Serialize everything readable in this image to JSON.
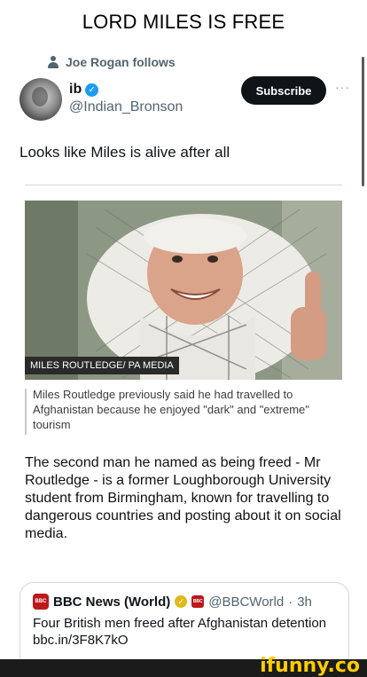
{
  "meme_title": "LORD MILES IS FREE",
  "social_context": {
    "text": "Joe Rogan follows",
    "icon": "person-icon"
  },
  "author": {
    "display_name": "ib",
    "verified_icon": "verified-badge-icon",
    "handle": "@Indian_Bronson",
    "subscribe_label": "Subscribe",
    "more_label": "···"
  },
  "tweet": {
    "text": "Looks like Miles is alive after all"
  },
  "article": {
    "photo_credit": "MILES ROUTLEDGE/ PA MEDIA",
    "photo_caption": "Miles Routledge previously said he had travelled to Afghanistan because he enjoyed \"dark\" and \"extreme\" tourism",
    "body": "The second man he named as being freed - Mr Routledge - is a former Loughborough University student from Birmingham, known for travelling to dangerous countries and posting about it on social media."
  },
  "quoted_tweet": {
    "logo_text": "BBC NEWS",
    "name": "BBC News (World)",
    "handle": "@BBCWorld",
    "time": "3h",
    "text": "Four British men freed after Afghanistan detention bbc.in/3F8K7kO"
  },
  "watermark": "ifunny.co",
  "colors": {
    "accent": "#1d9bf0",
    "gold_check": "#e2b719",
    "bbc_red": "#bb1919",
    "watermark": "#ffcc00"
  }
}
